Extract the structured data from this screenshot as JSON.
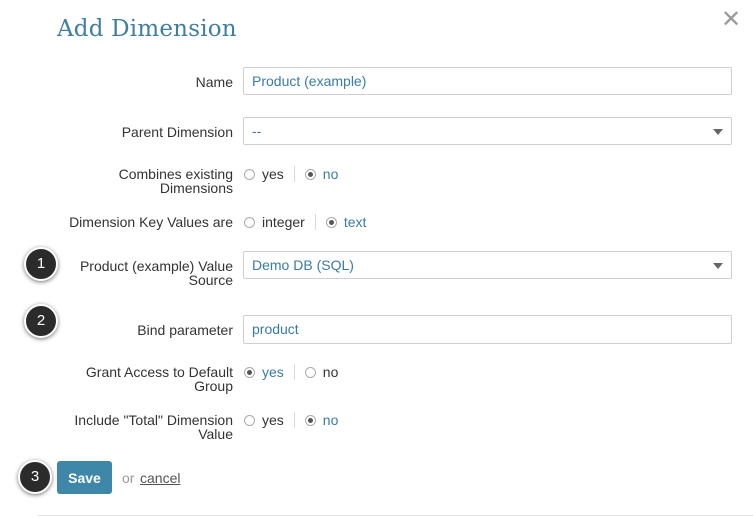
{
  "dialog": {
    "title": "Add Dimension",
    "close_icon": "close-icon"
  },
  "form": {
    "name": {
      "label": "Name",
      "value": "Product (example)"
    },
    "parent_dimension": {
      "label": "Parent Dimension",
      "value": "--"
    },
    "combines_existing": {
      "label_line1": "Combines existing",
      "label_line2": "Dimensions",
      "options": [
        "yes",
        "no"
      ],
      "selected": "no"
    },
    "key_values": {
      "label": "Dimension Key Values are",
      "options": [
        "integer",
        "text"
      ],
      "selected": "text"
    },
    "value_source": {
      "label_line1": "Product (example) Value",
      "label_line2": "Source",
      "value": "Demo DB (SQL)"
    },
    "bind_parameter": {
      "label": "Bind parameter",
      "value": "product"
    },
    "grant_access": {
      "label_line1": "Grant Access to Default",
      "label_line2": "Group",
      "options": [
        "yes",
        "no"
      ],
      "selected": "yes"
    },
    "include_total": {
      "label_line1": "Include \"Total\" Dimension",
      "label_line2": "Value",
      "options": [
        "yes",
        "no"
      ],
      "selected": "no"
    }
  },
  "actions": {
    "save_label": "Save",
    "or_text": "or",
    "cancel_label": "cancel"
  },
  "badges": [
    "1",
    "2",
    "3"
  ],
  "colors": {
    "accent": "#3f7fa2",
    "button": "#3f87a8",
    "value_text": "#3a7ba6"
  }
}
